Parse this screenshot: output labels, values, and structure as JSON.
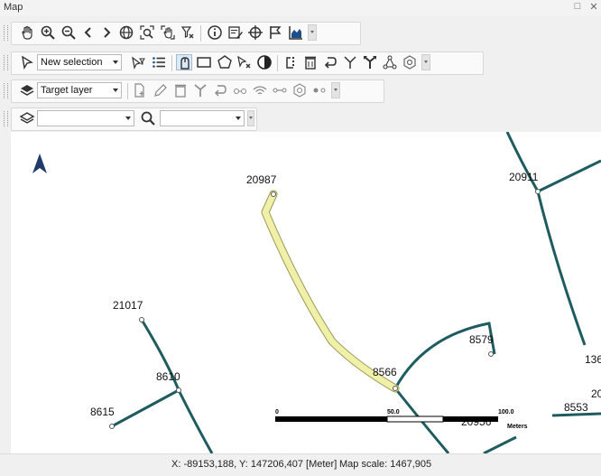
{
  "window": {
    "title": "Map",
    "restore_glyph": "□",
    "close_glyph": "✕"
  },
  "toolbar1": {
    "icons": [
      "pan-hand-icon",
      "zoom-in-icon",
      "zoom-out-icon",
      "previous-extent-icon",
      "next-extent-icon",
      "full-extent-icon",
      "zoom-to-selection-icon",
      "pan-to-selection-icon",
      "clear-selection-icon",
      "identify-icon",
      "attributes-icon",
      "coordinates-icon",
      "flag-icon",
      "profile-chart-icon"
    ]
  },
  "toolbar2": {
    "selection_mode": "New selection",
    "icons": [
      "select-pointer-icon",
      "filter-selection-icon",
      "list-icon",
      "select-pointer-active-icon",
      "rectangle-select-icon",
      "polygon-select-icon",
      "clear-selected-icon",
      "invert-selection-icon",
      "copy-selection-icon",
      "delete-selection-icon",
      "undo-icon",
      "merge-icon",
      "split-icon",
      "network-icon",
      "settings-icon"
    ]
  },
  "toolbar3": {
    "target_layer": "Target layer",
    "icons": [
      "layers-icon",
      "new-feature-icon",
      "edit-pencil-icon",
      "delete-feature-icon",
      "split-feature-icon",
      "undo-edit-icon",
      "snap-icon",
      "wifi-icon",
      "connect-icon",
      "polygon-edit-icon",
      "vertex-icon"
    ]
  },
  "toolbar4": {
    "layer_value": "",
    "search_value": ""
  },
  "map": {
    "north_arrow": "north-arrow-icon",
    "labels": [
      "20987",
      "20911",
      "21017",
      "8610",
      "8615",
      "8579",
      "8566",
      "136",
      "8553",
      "20",
      "20956"
    ],
    "scalebar": {
      "ticks": [
        "0",
        "50.0",
        "100.0"
      ],
      "unit": "Meters"
    },
    "colors": {
      "line": "#1e5c5f",
      "highlight": "#f0f0a8"
    }
  },
  "status": {
    "coords": "X: -89153,188, Y: 147206,407 [Meter]",
    "scale": "Map scale: 1467,905"
  }
}
